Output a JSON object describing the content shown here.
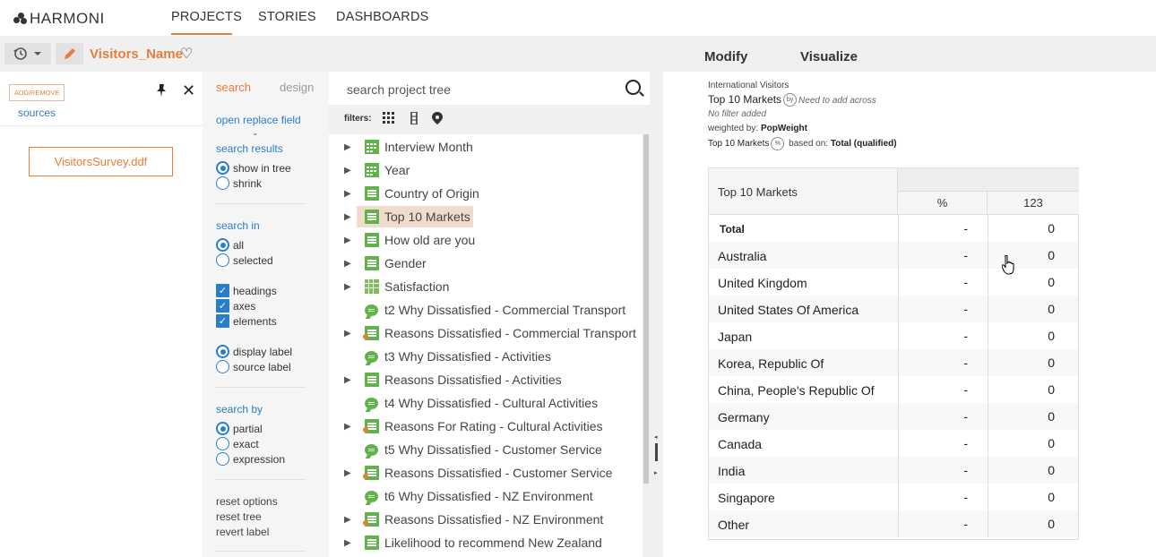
{
  "app": {
    "logo_text": "HARMONI"
  },
  "nav": {
    "tabs": [
      "PROJECTS",
      "STORIES",
      "DASHBOARDS"
    ],
    "active": "PROJECTS"
  },
  "toolbar": {
    "project_name": "Visitors_Name"
  },
  "right_tabs": [
    "Modify",
    "Visualize"
  ],
  "sources": {
    "add_remove": "ADD/REMOVE",
    "sources_link": "sources",
    "file": "VisitorsSurvey.ddf"
  },
  "options": {
    "tabs": {
      "search": "search",
      "design": "design"
    },
    "open_replace": "open replace field",
    "search_results": {
      "label": "search results",
      "options": [
        "show in tree",
        "shrink"
      ],
      "selected": "show in tree"
    },
    "search_in": {
      "label": "search in",
      "options": [
        "all",
        "selected"
      ],
      "selected": "all"
    },
    "checks": [
      "headings",
      "axes",
      "elements"
    ],
    "labels": {
      "options": [
        "display label",
        "source label"
      ],
      "selected": "display label"
    },
    "search_by": {
      "label": "search by",
      "options": [
        "partial",
        "exact",
        "expression"
      ],
      "selected": "partial"
    },
    "actions": [
      "reset options",
      "reset tree",
      "revert label"
    ]
  },
  "tree": {
    "search_placeholder": "search project tree",
    "filters_label": "filters:",
    "items": [
      {
        "label": "Interview Month",
        "icon": "calendar-icon",
        "expandable": true
      },
      {
        "label": "Year",
        "icon": "calendar-icon",
        "expandable": true
      },
      {
        "label": "Country of Origin",
        "icon": "list-icon",
        "expandable": true
      },
      {
        "label": "Top 10 Markets",
        "icon": "list-icon",
        "expandable": true,
        "highlighted": true
      },
      {
        "label": "How old are you",
        "icon": "list-icon",
        "expandable": true
      },
      {
        "label": "Gender",
        "icon": "list-icon",
        "expandable": true
      },
      {
        "label": "Satisfaction",
        "icon": "grid-icon",
        "expandable": true
      },
      {
        "label": "t2 Why Dissatisfied - Commercial Transport",
        "icon": "chat-icon",
        "expandable": false
      },
      {
        "label": "Reasons Dissatisfied - Commercial Transport",
        "icon": "list-dot-icon",
        "expandable": true
      },
      {
        "label": "t3 Why Dissatisfied - Activities",
        "icon": "chat-icon",
        "expandable": false
      },
      {
        "label": "Reasons Dissatisfied - Activities",
        "icon": "list-icon",
        "expandable": true
      },
      {
        "label": "t4 Why Dissatisfied - Cultural Activities",
        "icon": "chat-icon",
        "expandable": false
      },
      {
        "label": "Reasons For Rating - Cultural Activities",
        "icon": "list-dot-icon",
        "expandable": true
      },
      {
        "label": "t5 Why Dissatisfied - Customer Service",
        "icon": "chat-icon",
        "expandable": false
      },
      {
        "label": "Reasons Dissatisfied - Customer Service",
        "icon": "list-dot-icon",
        "expandable": true
      },
      {
        "label": "t6 Why Dissatisfied - NZ Environment",
        "icon": "chat-icon",
        "expandable": false
      },
      {
        "label": "Reasons Dissatisfied - NZ Environment",
        "icon": "list-dot-icon",
        "expandable": true
      },
      {
        "label": "Likelihood to recommend New Zealand",
        "icon": "list-icon",
        "expandable": true
      }
    ]
  },
  "table_meta": {
    "line1": "International Visitors",
    "line2_title": "Top 10 Markets",
    "line2_by": "by",
    "line2_note": "Need to add across",
    "line3": "No filter added",
    "line4_prefix": "weighted by:",
    "line4_value": "PopWeight",
    "line5_title": "Top 10 Markets",
    "line5_pct": "%",
    "line5_mid": "based on:",
    "line5_value": "Total (qualified)"
  },
  "table": {
    "row_header": "Top 10 Markets",
    "columns": [
      "%",
      "123"
    ],
    "rows": [
      {
        "label": "Total",
        "pct": "-",
        "count": "0",
        "total": true
      },
      {
        "label": "Australia",
        "pct": "-",
        "count": "0"
      },
      {
        "label": "United Kingdom",
        "pct": "-",
        "count": "0"
      },
      {
        "label": "United States Of America",
        "pct": "-",
        "count": "0"
      },
      {
        "label": "Japan",
        "pct": "-",
        "count": "0"
      },
      {
        "label": "Korea, Republic Of",
        "pct": "-",
        "count": "0"
      },
      {
        "label": "China, People's Republic Of",
        "pct": "-",
        "count": "0"
      },
      {
        "label": "Germany",
        "pct": "-",
        "count": "0"
      },
      {
        "label": "Canada",
        "pct": "-",
        "count": "0"
      },
      {
        "label": "India",
        "pct": "-",
        "count": "0"
      },
      {
        "label": "Singapore",
        "pct": "-",
        "count": "0"
      },
      {
        "label": "Other",
        "pct": "-",
        "count": "0"
      }
    ]
  },
  "colors": {
    "accent": "#e67e3b",
    "link": "#2a7ec8",
    "tree_icon": "#5fb34a"
  }
}
